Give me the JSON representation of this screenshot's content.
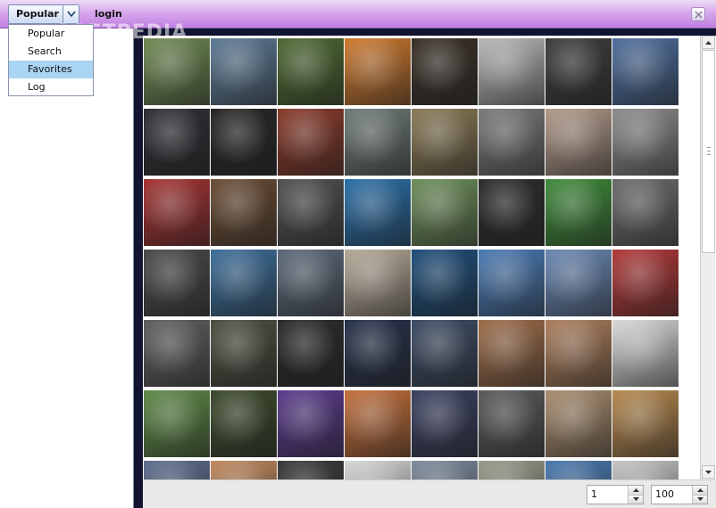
{
  "app": {
    "watermark": "SOFTPEDIA"
  },
  "toolbar": {
    "combo_selected": "Popular",
    "login_label": "login",
    "close_icon": "close-icon"
  },
  "dropdown": {
    "items": [
      {
        "label": "Popular",
        "selected": false
      },
      {
        "label": "Search",
        "selected": false
      },
      {
        "label": "Favorites",
        "selected": true
      },
      {
        "label": "Log",
        "selected": false
      }
    ]
  },
  "gallery": {
    "columns": 8,
    "thumbnails": [
      "#6f8a52",
      "#5d7a95",
      "#4e6a32",
      "#cf7a2e",
      "#3a3128",
      "#b8b8b8",
      "#3d3d3d",
      "#4e6f9e",
      "#2f2f35",
      "#272727",
      "#8a3a2a",
      "#6e7a78",
      "#8a7a55",
      "#7a7a7a",
      "#b29a8a",
      "#8d8d8d",
      "#a53232",
      "#6a4c34",
      "#505050",
      "#2a6fa8",
      "#6e8f5a",
      "#2d2d2d",
      "#3f8c3a",
      "#6c6c6c",
      "#4a4a4a",
      "#3c6e9a",
      "#5d6a7a",
      "#b6aa98",
      "#1f4f7c",
      "#4b7bb5",
      "#6a88b4",
      "#b23838",
      "#5f5f5f",
      "#4f4f42",
      "#2b2b2b",
      "#26314a",
      "#3c4b63",
      "#9e6e4a",
      "#ad7f5c",
      "#dadada",
      "#5e8a46",
      "#3c4a2c",
      "#5a3a8c",
      "#c4703c",
      "#3a4060",
      "#5a5a5a",
      "#a98d6e",
      "#b7894e",
      "#5e6e8e",
      "#c28a5e",
      "#3b3b3b",
      "#d9d9d9",
      "#7e8c9e",
      "#9a9a8a",
      "#4a7ab0",
      "#c6c6c6"
    ]
  },
  "pager": {
    "page_value": "1",
    "per_page_value": "100"
  }
}
